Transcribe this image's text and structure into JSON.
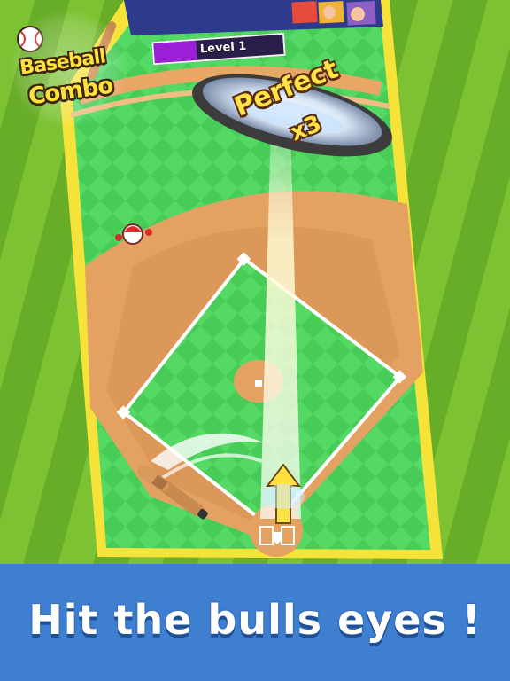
{
  "game": {
    "logo": {
      "line1": "Baseball",
      "line2": "Combo"
    },
    "level_label": "Level 1",
    "level_progress": 0.33,
    "feedback": {
      "text": "Perfect",
      "combo": "x3"
    }
  },
  "caption": "Hit the bulls eyes !",
  "colors": {
    "grass": "#4dd35a",
    "infield_dirt": "#e4a262",
    "banner": "#3f7fd0",
    "frame_yellow": "#f5e33a",
    "level_fill": "#9b1fd6",
    "perfect_text": "#ffe347"
  },
  "icons": [
    "baseball-icon",
    "bat-icon",
    "arrow-up-icon",
    "home-plate-icon",
    "player-avatar-icon"
  ]
}
